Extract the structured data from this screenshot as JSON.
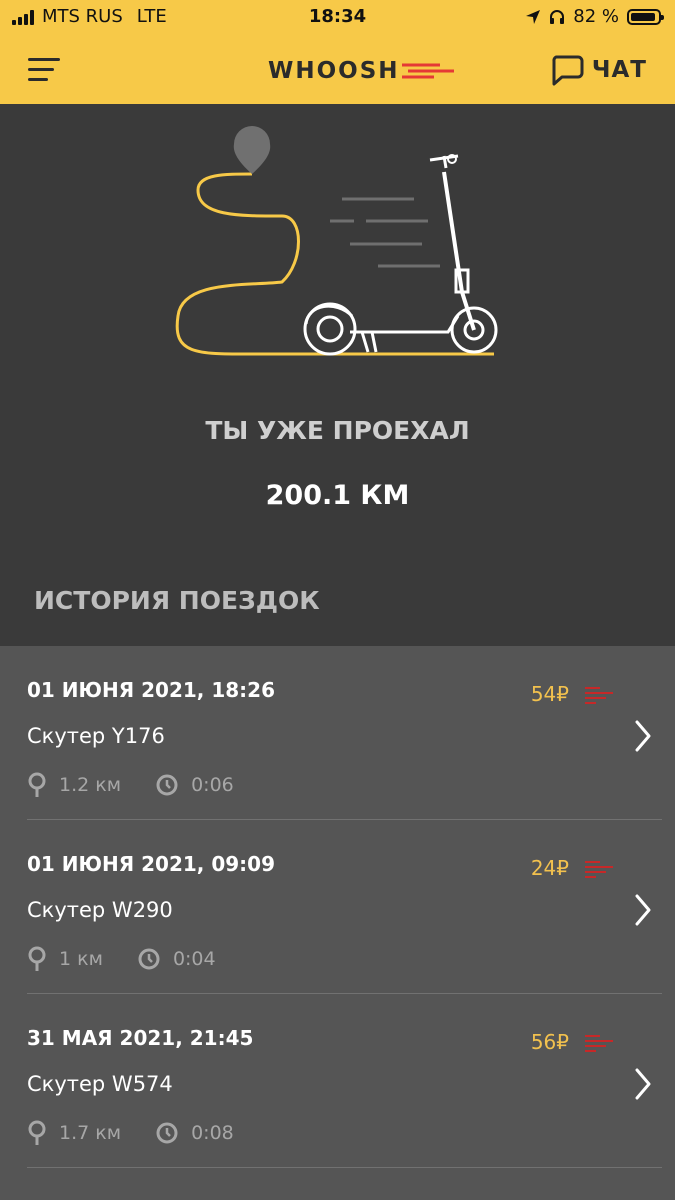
{
  "status_bar": {
    "carrier": "MTS RUS",
    "network": "LTE",
    "time": "18:34",
    "battery": "82 %",
    "icons": [
      "signal-icon",
      "location-arrow-icon",
      "headphones-icon",
      "battery-icon"
    ]
  },
  "header": {
    "logo": "WHOOSH",
    "chat_label": "ЧАТ",
    "icons": [
      "menu-icon",
      "chat-bubble-icon"
    ]
  },
  "hero": {
    "title": "ТЫ УЖЕ ПРОЕХАЛ",
    "distance": "200.1 КМ",
    "illustration": "scooter-route-illustration"
  },
  "history": {
    "title": "ИСТОРИЯ ПОЕЗДОК",
    "trips": [
      {
        "date": "01 ИЮНЯ 2021, 18:26",
        "name": "Скутер Y176",
        "price": "54₽",
        "distance": "1.2 км",
        "duration": "0:06"
      },
      {
        "date": "01 ИЮНЯ 2021, 09:09",
        "name": "Скутер W290",
        "price": "24₽",
        "distance": "1 км",
        "duration": "0:04"
      },
      {
        "date": "31 МАЯ 2021, 21:45",
        "name": "Скутер W574",
        "price": "56₽",
        "distance": "1.7 км",
        "duration": "0:08"
      }
    ]
  },
  "colors": {
    "brand_yellow": "#f7c948",
    "hero_bg": "#3a3a3a",
    "list_bg": "#555555",
    "price": "#f2c14e",
    "accent_red": "#e53935"
  }
}
